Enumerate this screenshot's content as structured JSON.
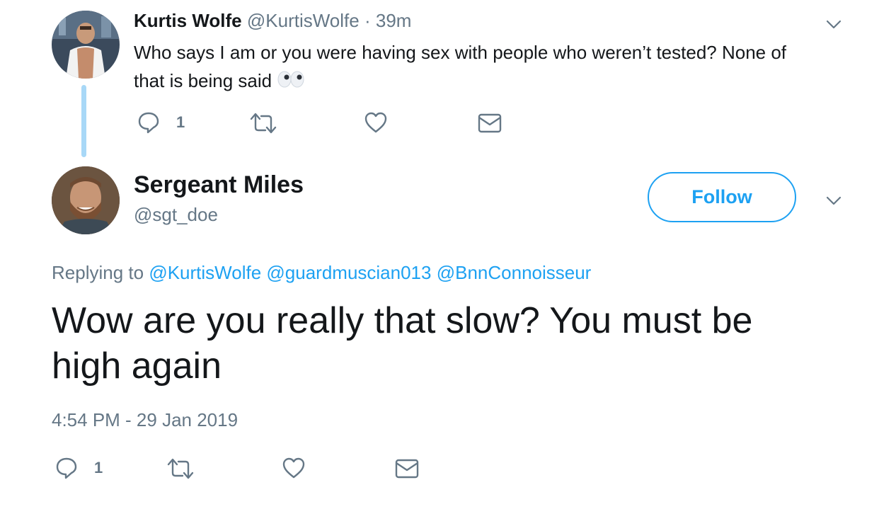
{
  "reply_tweet": {
    "name": "Kurtis Wolfe",
    "handle": "@KurtisWolfe",
    "separator": "·",
    "time": "39m",
    "text_line1": "Who says I am or you were having sex with people who weren’t tested? None of",
    "text_line2": "that is being said",
    "emoji": "👀",
    "actions": {
      "reply_count": "1"
    },
    "icons": [
      "reply-icon",
      "retweet-icon",
      "like-icon",
      "dm-icon",
      "chevron-down-icon"
    ]
  },
  "main_tweet": {
    "name": "Sergeant Miles",
    "handle": "@sgt_doe",
    "follow_label": "Follow",
    "replying_prefix": "Replying to",
    "mentions": [
      "@KurtisWolfe",
      "@guardmuscian013",
      "@BnnConnoisseur"
    ],
    "text_line1": "Wow are you really that slow? You must be",
    "text_line2": "high again",
    "timestamp": "4:54 PM - 29 Jan 2019",
    "actions": {
      "reply_count": "1"
    }
  },
  "colors": {
    "accent": "#1da1f2",
    "muted": "#657786",
    "thread_line": "#a8d8f7",
    "text": "#14171a"
  }
}
